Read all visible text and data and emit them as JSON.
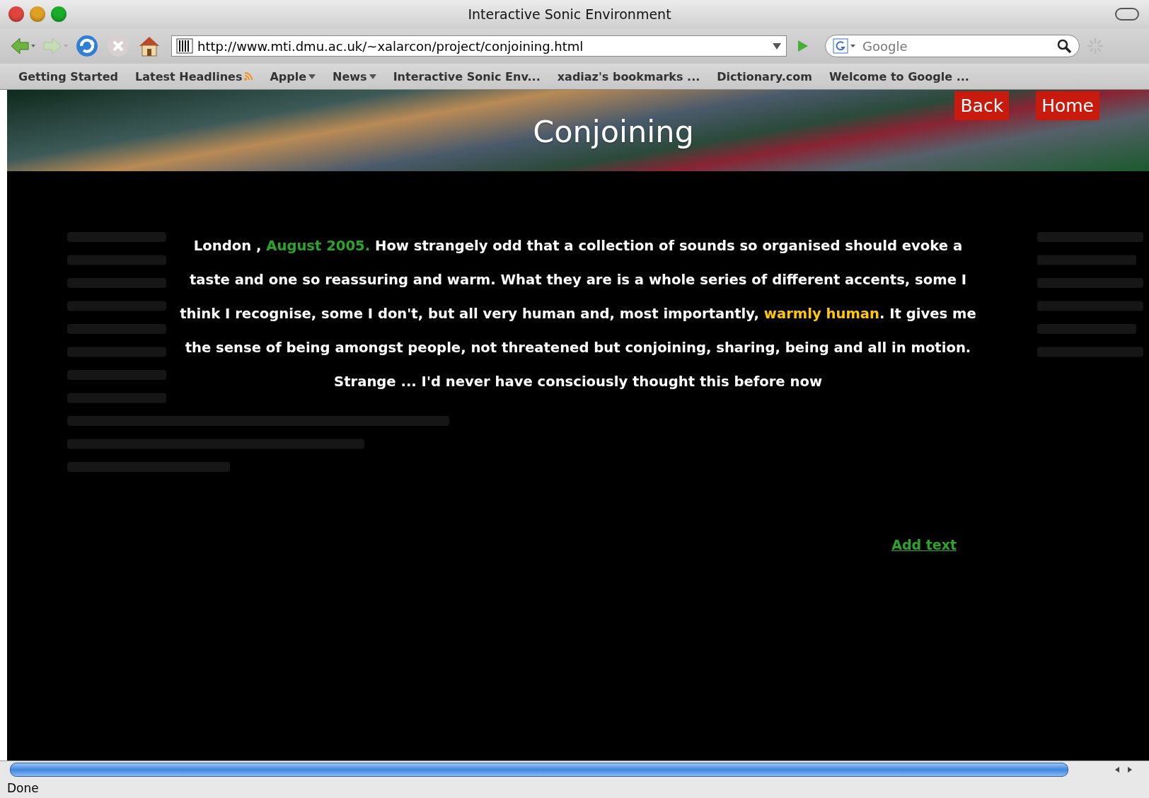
{
  "window": {
    "title": "Interactive Sonic Environment"
  },
  "toolbar": {
    "url": "http://www.mti.dmu.ac.uk/~xalarcon/project/conjoining.html",
    "search": {
      "placeholder": "Google"
    }
  },
  "bookmarks": [
    {
      "label": "Getting Started",
      "kind": "link"
    },
    {
      "label": "Latest Headlines",
      "kind": "feed"
    },
    {
      "label": "Apple",
      "kind": "folder"
    },
    {
      "label": "News",
      "kind": "folder"
    },
    {
      "label": "Interactive Sonic Env...",
      "kind": "link"
    },
    {
      "label": "xadiaz's bookmarks ...",
      "kind": "link"
    },
    {
      "label": "Dictionary.com",
      "kind": "link"
    },
    {
      "label": "Welcome to Google ...",
      "kind": "link"
    }
  ],
  "page": {
    "title": "Conjoining",
    "nav": [
      "Back",
      "Home"
    ],
    "paragraph": [
      {
        "kind": "place",
        "text": "London"
      },
      {
        "kind": "plain",
        "text": " , "
      },
      {
        "kind": "date",
        "text": "August 2005."
      },
      {
        "kind": "plain",
        "text": " How strangely odd that a collection of sounds so organised should evoke a taste and one so reassuring and warm. What they are is a whole series of different accents, some I think I recognise, some I don't, but all very human and, most importantly, "
      },
      {
        "kind": "highlight",
        "text": "warmly human"
      },
      {
        "kind": "plain",
        "text": ". It gives me the sense of being amongst people, not threatened but conjoining, sharing, being and all in motion. Strange ... I'd never have consciously thought this before now"
      }
    ],
    "add_text_link": "Add text"
  },
  "status_bar": {
    "text": "Done"
  }
}
